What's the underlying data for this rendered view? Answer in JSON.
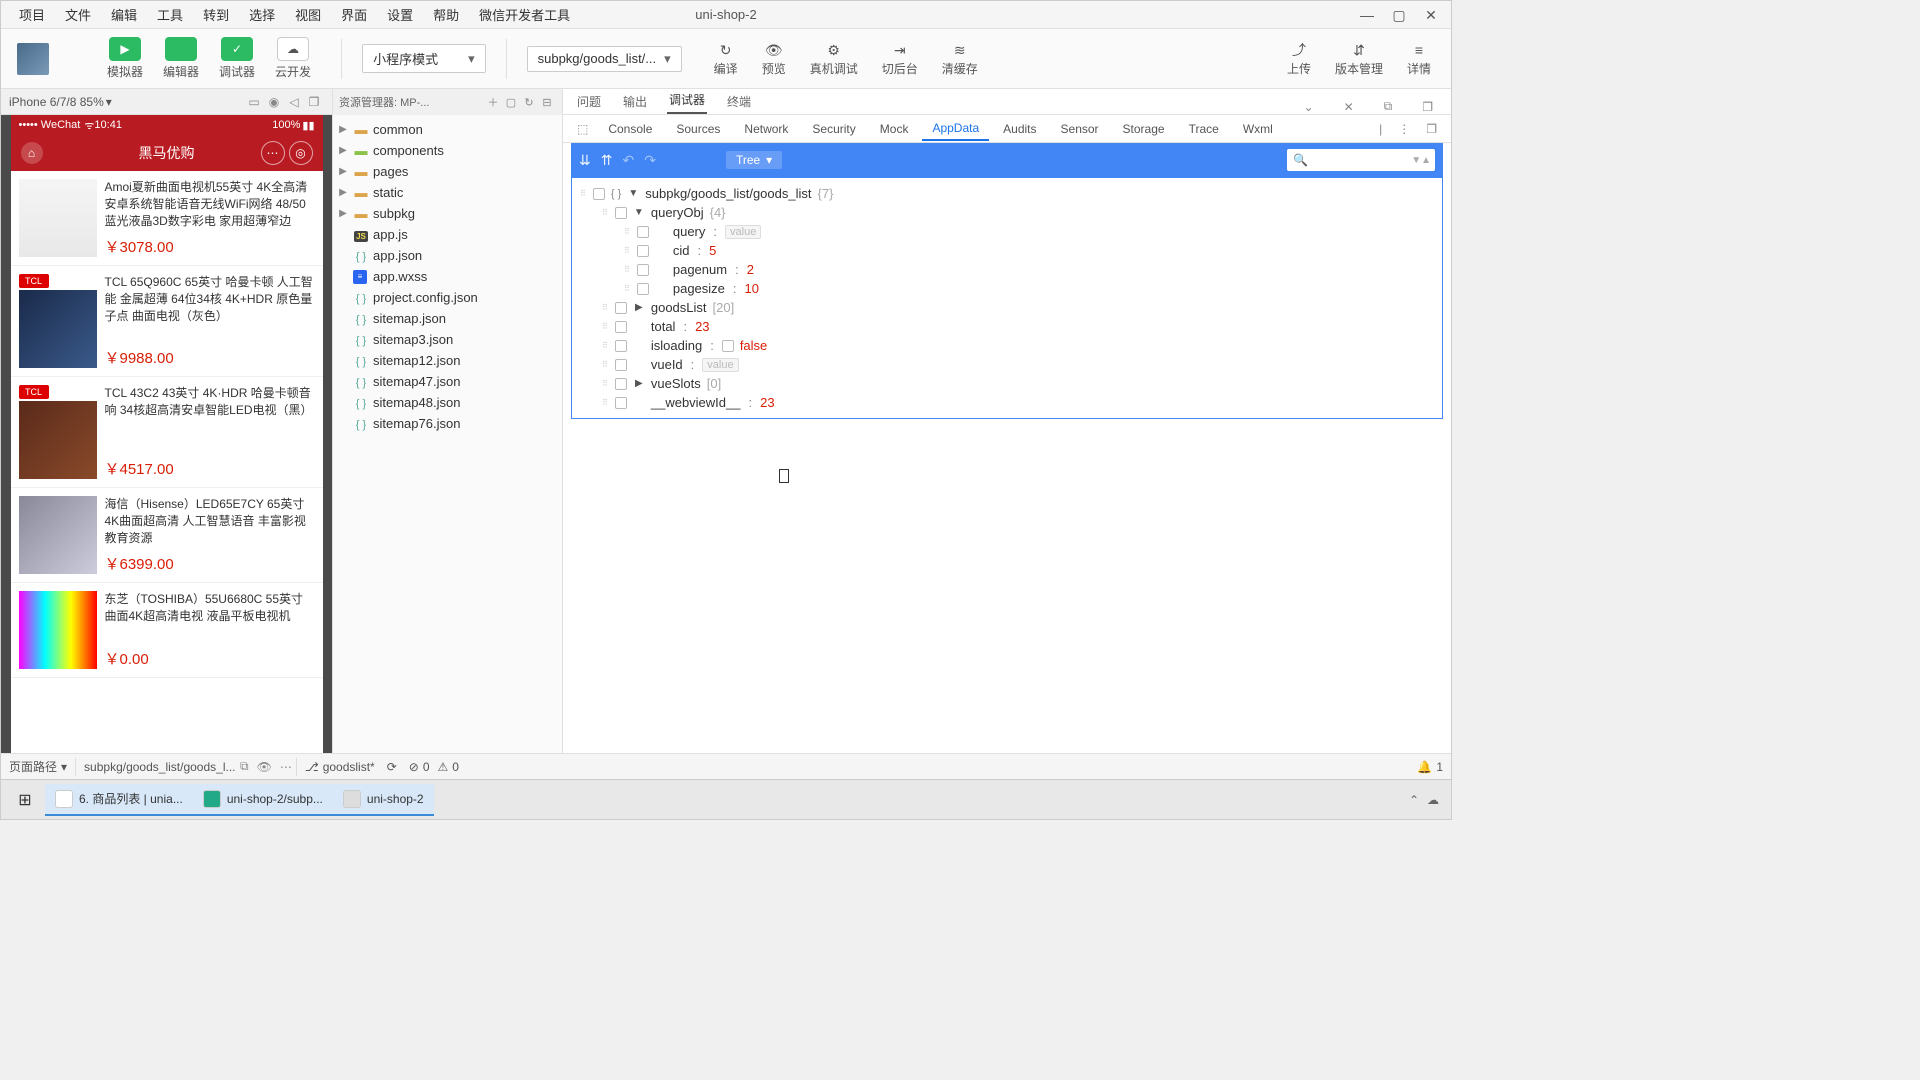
{
  "window": {
    "title": "uni-shop-2"
  },
  "menubar": [
    "项目",
    "文件",
    "编辑",
    "工具",
    "转到",
    "选择",
    "视图",
    "界面",
    "设置",
    "帮助",
    "微信开发者工具"
  ],
  "toolbar": {
    "modes": [
      {
        "icon": "▶",
        "label": "模拟器",
        "green": true
      },
      {
        "icon": "</>",
        "label": "编辑器",
        "green": true
      },
      {
        "icon": "✓",
        "label": "调试器",
        "green": true
      },
      {
        "icon": "☁",
        "label": "云开发",
        "green": false
      }
    ],
    "scheme_dd": "小程序模式",
    "page_dd": "subpkg/goods_list/...",
    "mid_tools": [
      {
        "icon": "↻",
        "label": "编译"
      },
      {
        "icon": "👁",
        "label": "预览"
      },
      {
        "icon": "⚙",
        "label": "真机调试"
      },
      {
        "icon": "⇥",
        "label": "切后台"
      },
      {
        "icon": "≋",
        "label": "清缓存"
      }
    ],
    "right_tools": [
      {
        "icon": "⤴",
        "label": "上传"
      },
      {
        "icon": "⇵",
        "label": "版本管理"
      },
      {
        "icon": "≡",
        "label": "详情"
      }
    ]
  },
  "simulator": {
    "device": "iPhone 6/7/8 85%",
    "status": {
      "carrier": "••••• WeChat",
      "wifi": "⌃",
      "time": "10:41",
      "battery": "100%"
    },
    "nav": {
      "title": "黑马优购"
    },
    "goods": [
      {
        "brand": "",
        "name": "Amoi夏新曲面电视机55英寸 4K全高清安卓系统智能语音无线WiFi网络 48/50蓝光液晶3D数字彩电 家用超薄窄边",
        "price": "￥3078.00",
        "img": "g-img-1"
      },
      {
        "brand": "TCL",
        "name": "TCL 65Q960C 65英寸 哈曼卡顿 人工智能 金属超薄 64位34核 4K+HDR 原色量子点 曲面电视（灰色）",
        "price": "￥9988.00",
        "img": "g-img-2"
      },
      {
        "brand": "TCL",
        "name": "TCL 43C2 43英寸 4K·HDR 哈曼卡顿音响 34核超高清安卓智能LED电视（黑）",
        "price": "￥4517.00",
        "img": "g-img-3"
      },
      {
        "brand": "",
        "name": "海信（Hisense）LED65E7CY 65英寸 4K曲面超高清 人工智慧语音 丰富影视教育资源",
        "price": "￥6399.00",
        "img": "g-img-4"
      },
      {
        "brand": "",
        "name": "东芝（TOSHIBA）55U6680C 55英寸 曲面4K超高清电视 液晶平板电视机",
        "price": "￥0.00",
        "img": "g-img-5"
      }
    ]
  },
  "explorer": {
    "title": "资源管理器: MP-...",
    "folders": [
      {
        "name": "common",
        "type": "folder"
      },
      {
        "name": "components",
        "type": "folder-g"
      },
      {
        "name": "pages",
        "type": "folder"
      },
      {
        "name": "static",
        "type": "folder"
      },
      {
        "name": "subpkg",
        "type": "folder"
      }
    ],
    "files": [
      {
        "name": "app.js",
        "type": "js"
      },
      {
        "name": "app.json",
        "type": "json"
      },
      {
        "name": "app.wxss",
        "type": "wxss"
      },
      {
        "name": "project.config.json",
        "type": "json"
      },
      {
        "name": "sitemap.json",
        "type": "json"
      },
      {
        "name": "sitemap3.json",
        "type": "json"
      },
      {
        "name": "sitemap12.json",
        "type": "json"
      },
      {
        "name": "sitemap47.json",
        "type": "json"
      },
      {
        "name": "sitemap48.json",
        "type": "json"
      },
      {
        "name": "sitemap76.json",
        "type": "json"
      }
    ]
  },
  "debug": {
    "outer_tabs": [
      "问题",
      "输出",
      "调试器",
      "终端"
    ],
    "outer_active": 2,
    "devtools_tabs": [
      "Console",
      "Sources",
      "Network",
      "Security",
      "Mock",
      "AppData",
      "Audits",
      "Sensor",
      "Storage",
      "Trace",
      "Wxml"
    ],
    "devtools_active": 5,
    "tree_dd": "Tree",
    "root": {
      "path": "subpkg/goods_list/goods_list",
      "count": "{7}"
    },
    "items": [
      {
        "indent": 1,
        "expander": "▼",
        "key": "queryObj",
        "meta": "{4}"
      },
      {
        "indent": 2,
        "key": "query",
        "placeholder": "value"
      },
      {
        "indent": 2,
        "key": "cid",
        "num": "5"
      },
      {
        "indent": 2,
        "key": "pagenum",
        "num": "2"
      },
      {
        "indent": 2,
        "key": "pagesize",
        "num": "10"
      },
      {
        "indent": 1,
        "expander": "▶",
        "key": "goodsList",
        "meta": "[20]"
      },
      {
        "indent": 1,
        "key": "total",
        "num": "23"
      },
      {
        "indent": 1,
        "key": "isloading",
        "checkbox": true,
        "bool": "false"
      },
      {
        "indent": 1,
        "key": "vueId",
        "placeholder": "value"
      },
      {
        "indent": 1,
        "expander": "▶",
        "key": "vueSlots",
        "meta": "[0]"
      },
      {
        "indent": 1,
        "key": "__webviewId__",
        "num": "23"
      }
    ]
  },
  "status": {
    "left_label": "页面路径",
    "path": "subpkg/goods_list/goods_l...",
    "branch": "goodslist*",
    "errors": "0",
    "warnings": "0",
    "notif": "1"
  },
  "taskbar": {
    "tasks": [
      {
        "label": "6. 商品列表 | unia...",
        "color": "#f44",
        "active": true,
        "iconbg": "#fff"
      },
      {
        "label": "uni-shop-2/subp...",
        "color": "#2a8",
        "active": true,
        "iconbg": "#2a8"
      },
      {
        "label": "uni-shop-2",
        "color": "#888",
        "active": true,
        "iconbg": "#ddd"
      }
    ]
  }
}
